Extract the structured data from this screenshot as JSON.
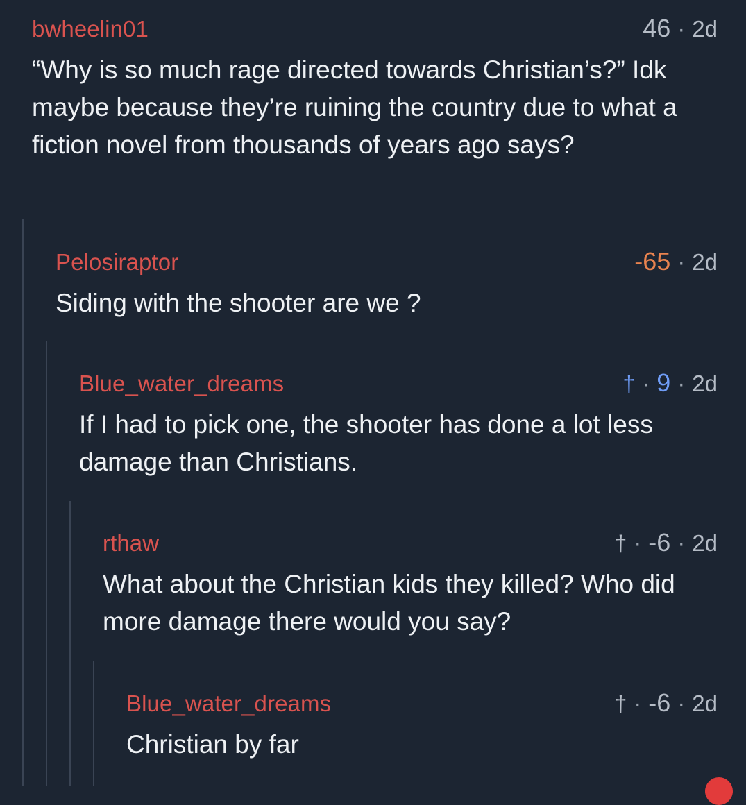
{
  "comments": [
    {
      "username": "bwheelin01",
      "score": "46",
      "age": "2d",
      "separator": "·",
      "body": "“Why is so much rage directed towards Christian’s?” Idk maybe because they’re ruining the country due to what a fiction novel from thousands of years ago says?"
    },
    {
      "username": "Pelosiraptor",
      "score": "-65",
      "age": "2d",
      "separator": "·",
      "body": "Siding with the shooter are we ?"
    },
    {
      "username": "Blue_water_dreams",
      "vote_icon": "†",
      "score": "9",
      "age": "2d",
      "separator": "·",
      "body": "If I had to pick one, the shooter has done a lot less damage than Christians."
    },
    {
      "username": "rthaw",
      "vote_icon": "†",
      "score": "-6",
      "age": "2d",
      "separator": "·",
      "body": "What about the Christian kids they killed? Who did more damage there would you say?"
    },
    {
      "username": "Blue_water_dreams",
      "vote_icon": "†",
      "score": "-6",
      "age": "2d",
      "separator": "·",
      "body": "Christian by far"
    }
  ],
  "colors": {
    "background": "#1c2532",
    "username": "#d9534f",
    "negative_score": "#e9834f",
    "upvoted": "#6f9cf5",
    "thread_line": "#3a4454",
    "notification_dot": "#e23b3b"
  }
}
